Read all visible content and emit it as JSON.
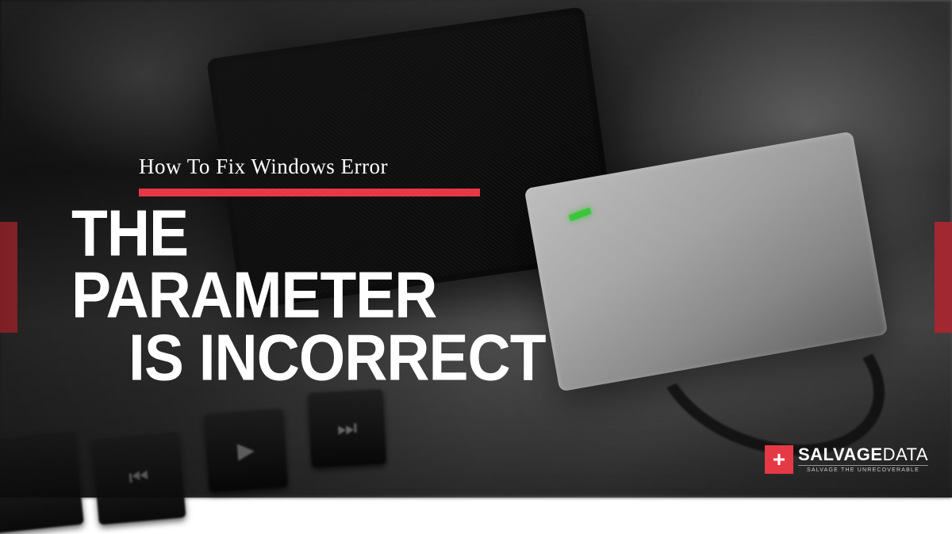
{
  "hero": {
    "subtitle": "How To Fix Windows Error",
    "headline_line1": "THE PARAMETER",
    "headline_line2": "IS INCORRECT"
  },
  "brand": {
    "plus_symbol": "+",
    "name_bold": "SALVAGE",
    "name_thin": "DATA",
    "tagline": "SALVAGE THE UNRECOVERABLE"
  },
  "colors": {
    "accent": "#e63946",
    "text": "#ffffff"
  }
}
